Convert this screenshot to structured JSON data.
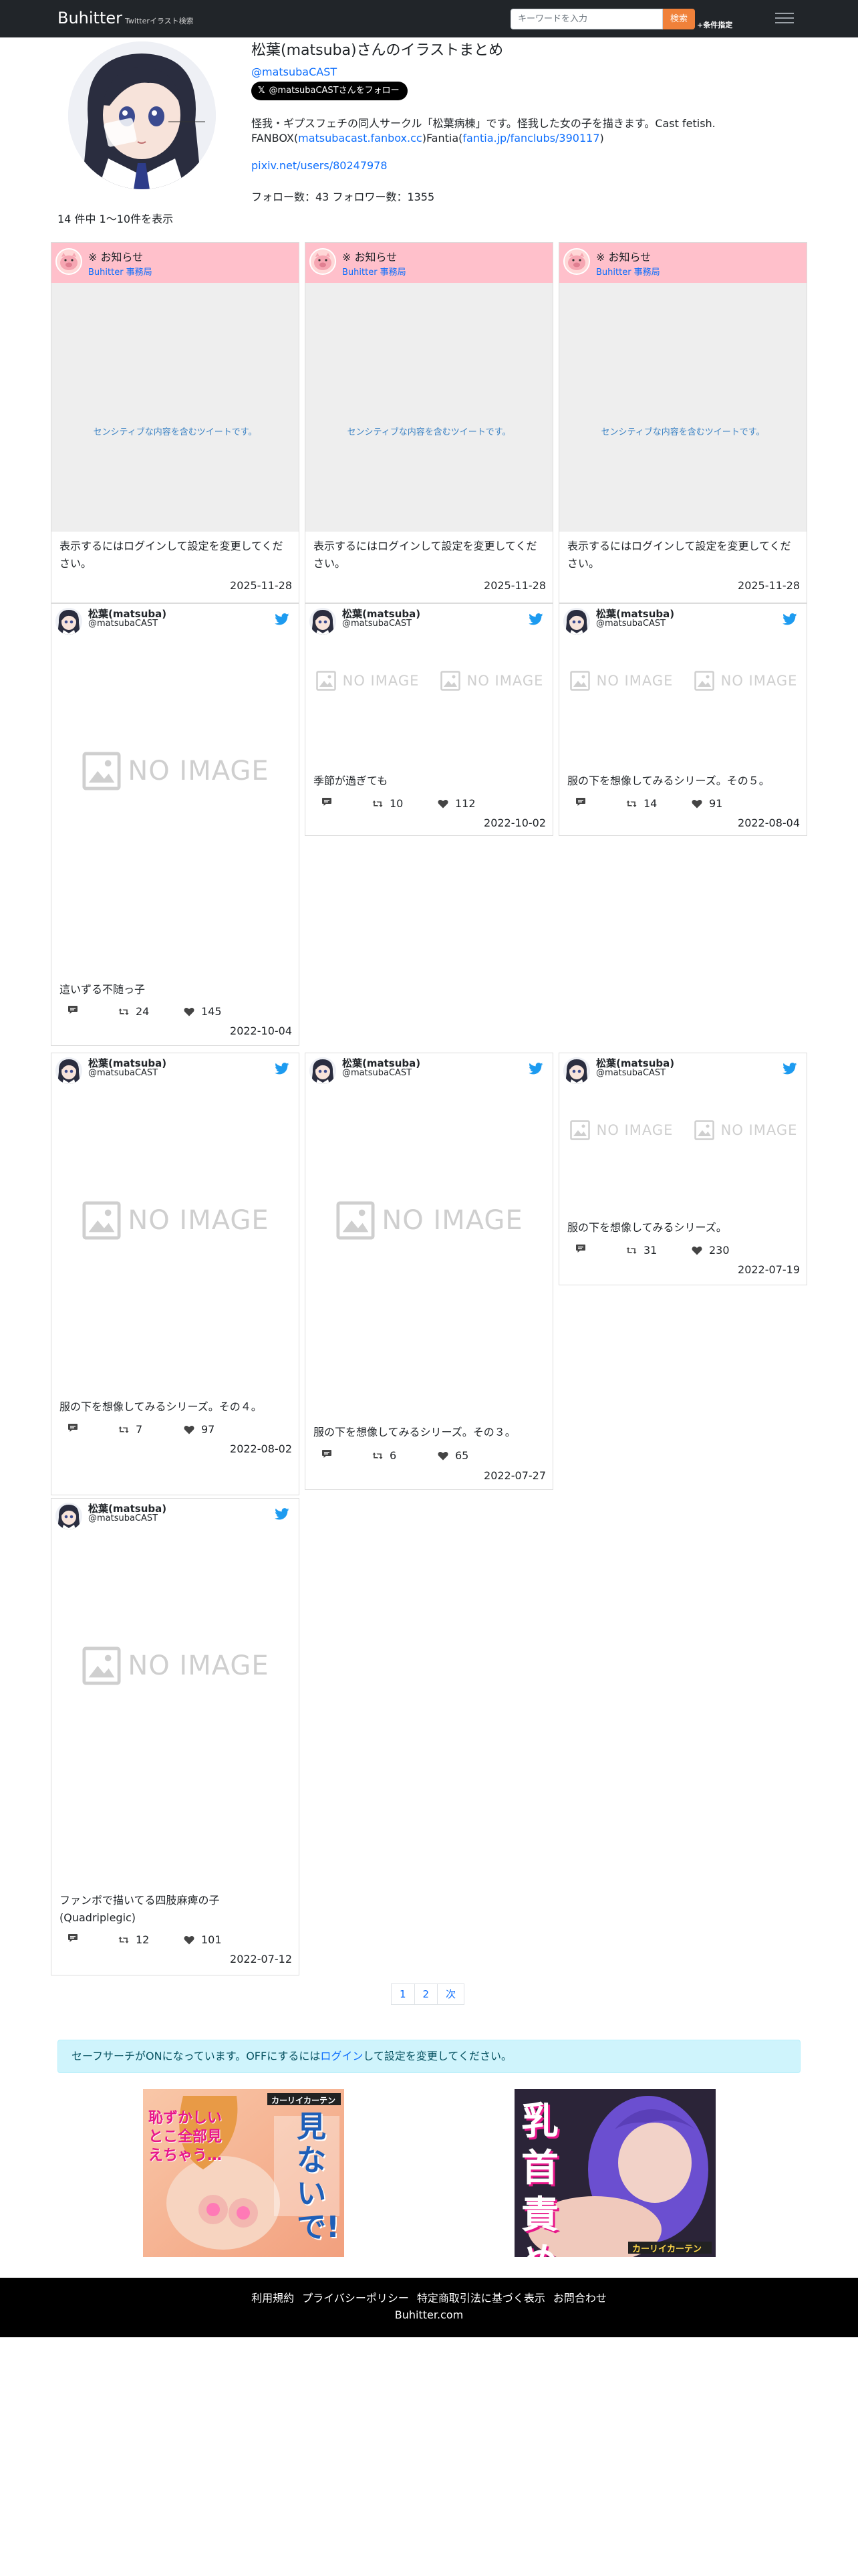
{
  "navbar": {
    "brand": "Buhitter",
    "brand_sub": "Twitterイラスト検索",
    "search_placeholder": "キーワードを入力",
    "search_button": "検索",
    "conditions_link": "+条件指定"
  },
  "profile": {
    "title": "松葉(matsuba)さんのイラストまとめ",
    "handle": "@matsubaCAST",
    "follow_button": "@matsubaCASTさんをフォロー",
    "bio_line1": "怪我・ギプスフェチの同人サークル「松葉病棟」です。怪我した女の子を描きます。Cast fetish.",
    "bio_fanbox_prefix": "FANBOX(",
    "bio_fanbox_link": "matsubacast.fanbox.cc",
    "bio_fantia_prefix": ")Fantia(",
    "bio_fantia_link": "fantia.jp/fanclubs/390117",
    "bio_suffix": ")",
    "pixiv_link": "pixiv.net/users/80247978",
    "stats": "フォロー数：43 フォロワー数：1355"
  },
  "result_count": "14 件中 1〜10件を表示",
  "notices": [
    {
      "title": "※ お知らせ",
      "from": "Buhitter 事務局",
      "sensitive": "センシティブな内容を含むツイートです。",
      "body": "表示するにはログインして設定を変更してください。",
      "date": "2025-11-28"
    },
    {
      "title": "※ お知らせ",
      "from": "Buhitter 事務局",
      "sensitive": "センシティブな内容を含むツイートです。",
      "body": "表示するにはログインして設定を変更してください。",
      "date": "2025-11-28"
    },
    {
      "title": "※ お知らせ",
      "from": "Buhitter 事務局",
      "sensitive": "センシティブな内容を含むツイートです。",
      "body": "表示するにはログインして設定を変更してください。",
      "date": "2025-11-28"
    }
  ],
  "tweets": [
    {
      "name": "松葉(matsuba)",
      "handle": "@matsubaCAST",
      "no_image": "NO IMAGE",
      "text": "這いずる不随っ子",
      "retweets": "24",
      "likes": "145",
      "date": "2022-10-04"
    },
    {
      "name": "松葉(matsuba)",
      "handle": "@matsubaCAST",
      "no_image": "NO IMAGE",
      "text": "季節が過ぎても",
      "retweets": "10",
      "likes": "112",
      "date": "2022-10-02"
    },
    {
      "name": "松葉(matsuba)",
      "handle": "@matsubaCAST",
      "no_image": "NO IMAGE",
      "text": "服の下を想像してみるシリーズ。その５。",
      "retweets": "14",
      "likes": "91",
      "date": "2022-08-04"
    },
    {
      "name": "松葉(matsuba)",
      "handle": "@matsubaCAST",
      "no_image": "NO IMAGE",
      "text": "服の下を想像してみるシリーズ。その４。",
      "retweets": "7",
      "likes": "97",
      "date": "2022-08-02"
    },
    {
      "name": "松葉(matsuba)",
      "handle": "@matsubaCAST",
      "no_image": "NO IMAGE",
      "text": "服の下を想像してみるシリーズ。その３。",
      "retweets": "6",
      "likes": "65",
      "date": "2022-07-27"
    },
    {
      "name": "松葉(matsuba)",
      "handle": "@matsubaCAST",
      "no_image": "NO IMAGE",
      "text": "服の下を想像してみるシリーズ。",
      "retweets": "31",
      "likes": "230",
      "date": "2022-07-19"
    },
    {
      "name": "松葉(matsuba)",
      "handle": "@matsubaCAST",
      "no_image": "NO IMAGE",
      "text": "ファンボで描いてる四肢麻痺の子(Quadriplegic)",
      "retweets": "12",
      "likes": "101",
      "date": "2022-07-12"
    }
  ],
  "pagination": {
    "page1": "1",
    "page2": "2",
    "next": "次"
  },
  "alert": {
    "prefix": "セーフサーチがONになっています。OFFにするには",
    "link": "ログイン",
    "suffix": "して設定を変更してください。"
  },
  "ads": {
    "ad1_logo": "カーリイカーテン",
    "ad1_title": "見ないで!",
    "ad1_sub": "恥ずかしいとこ全部見えちゃう…",
    "ad2_logo": "カーリイカーテン",
    "ad2_title": "乳首責め"
  },
  "footer": {
    "terms": "利用規約",
    "privacy": "プライバシーポリシー",
    "commerce": "特定商取引法に基づく表示",
    "contact": "お問合わせ",
    "domain": "Buhitter.com"
  },
  "colors": {
    "navbar": "#212529",
    "accent_orange": "#f0813a",
    "link": "#0d6efd",
    "notice_pink": "#ffc0cb",
    "twitter_blue": "#1d9bf0",
    "alert_bg": "#cff4fc",
    "footer": "#000000"
  },
  "icons": [
    "hamburger-icon",
    "twitter-bird-icon",
    "reply-icon",
    "retweet-icon",
    "like-heart-icon",
    "no-image-icon",
    "x-logo-icon",
    "pig-icon"
  ]
}
